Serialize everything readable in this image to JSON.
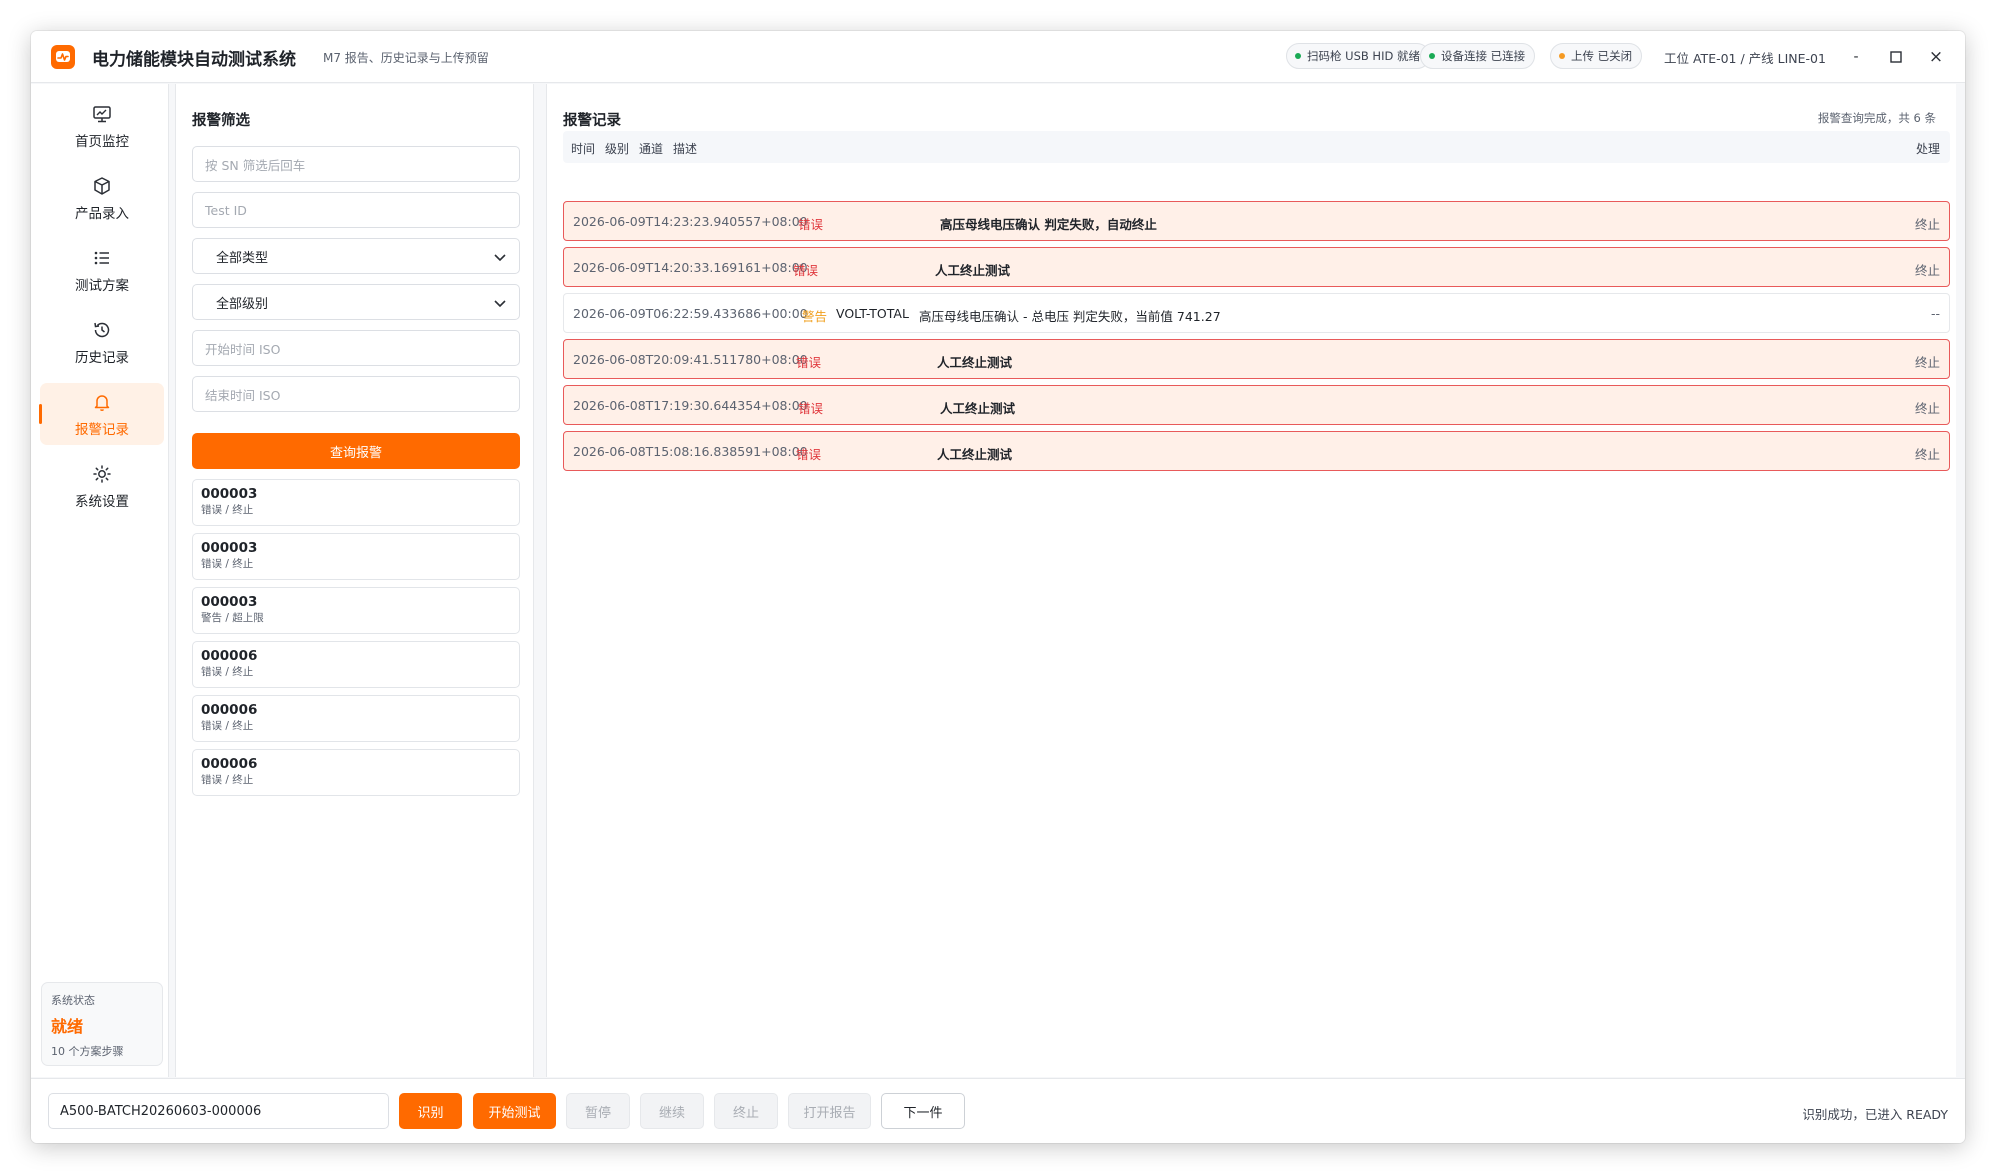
{
  "app": {
    "title": "电力储能模块自动测试系统",
    "subtitle": "M7 报告、历史记录与上传预留",
    "brand_color": "#ff6a00"
  },
  "status_pills": [
    {
      "label": "扫码枪 USB HID 就绪",
      "dot_color": "#1aaa55"
    },
    {
      "label": "设备连接 已连接",
      "dot_color": "#1aaa55"
    },
    {
      "label": "上传 已关闭",
      "dot_color": "#f59a23"
    }
  ],
  "station": "工位 ATE-01 / 产线 LINE-01",
  "window_controls": {
    "minimize": "-",
    "close": "×"
  },
  "sidebar": {
    "items": [
      {
        "label": "首页监控",
        "icon": "monitor-icon"
      },
      {
        "label": "产品录入",
        "icon": "box-icon"
      },
      {
        "label": "测试方案",
        "icon": "list-icon"
      },
      {
        "label": "历史记录",
        "icon": "history-icon"
      },
      {
        "label": "报警记录",
        "icon": "bell-icon",
        "active": true
      },
      {
        "label": "系统设置",
        "icon": "gear-icon"
      }
    ],
    "system_status": {
      "label": "系统状态",
      "value": "就绪",
      "sub": "10 个方案步骤"
    }
  },
  "filter": {
    "title": "报警筛选",
    "sn_placeholder": "按 SN 筛选后回车",
    "testid_placeholder": "Test ID",
    "type_select": "全部类型",
    "level_select": "全部级别",
    "start_placeholder": "开始时间 ISO",
    "end_placeholder": "结束时间 ISO",
    "query_label": "查询报警",
    "results": [
      {
        "code": "000003",
        "sub": "错误 / 终止"
      },
      {
        "code": "000003",
        "sub": "错误 / 终止"
      },
      {
        "code": "000003",
        "sub": "警告 / 超上限"
      },
      {
        "code": "000006",
        "sub": "错误 / 终止"
      },
      {
        "code": "000006",
        "sub": "错误 / 终止"
      },
      {
        "code": "000006",
        "sub": "错误 / 终止"
      }
    ]
  },
  "alarms": {
    "title": "报警记录",
    "result_note": "报警查询完成，共 6 条",
    "columns": {
      "time": "时间",
      "level": "级别",
      "channel": "通道",
      "desc": "描述",
      "action": "处理"
    },
    "rows": [
      {
        "time": "2026-06-09T14:23:23.940557+08:00",
        "level": "错误",
        "kind": "error",
        "channel": "",
        "desc": "高压母线电压确认 判定失败，自动终止",
        "action": "终止"
      },
      {
        "time": "2026-06-09T14:20:33.169161+08:00",
        "level": "错误",
        "kind": "error",
        "channel": "",
        "desc": "人工终止测试",
        "action": "终止"
      },
      {
        "time": "2026-06-09T06:22:59.433686+00:00",
        "level": "警告",
        "kind": "warn",
        "channel": "VOLT-TOTAL",
        "desc": "高压母线电压确认 - 总电压 判定失败，当前值 741.27",
        "action": "--"
      },
      {
        "time": "2026-06-08T20:09:41.511780+08:00",
        "level": "错误",
        "kind": "error",
        "channel": "",
        "desc": "人工终止测试",
        "action": "终止"
      },
      {
        "time": "2026-06-08T17:19:30.644354+08:00",
        "level": "错误",
        "kind": "error",
        "channel": "",
        "desc": "人工终止测试",
        "action": "终止"
      },
      {
        "time": "2026-06-08T15:08:16.838591+08:00",
        "level": "错误",
        "kind": "error",
        "channel": "",
        "desc": "人工终止测试",
        "action": "终止"
      }
    ]
  },
  "bottombar": {
    "sn_value": "A500-BATCH20260603-000006",
    "buttons": {
      "identify": "识别",
      "start": "开始测试",
      "pause": "暂停",
      "resume": "继续",
      "stop": "终止",
      "open_report": "打开报告",
      "next": "下一件"
    },
    "status_message": "识别成功，已进入 READY"
  }
}
